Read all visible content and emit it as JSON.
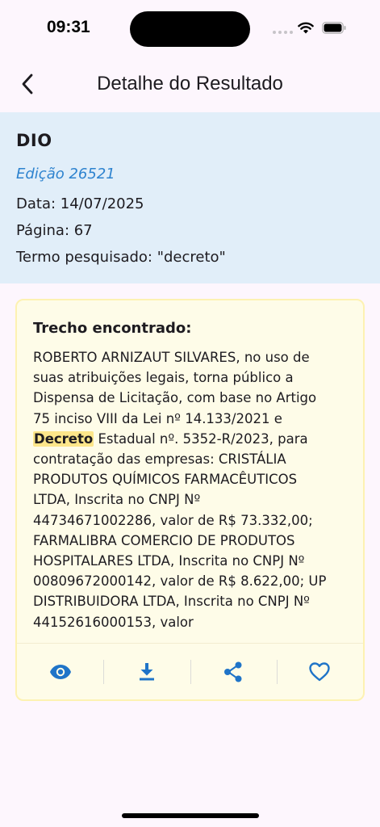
{
  "status_bar": {
    "time": "09:31"
  },
  "app_bar": {
    "title": "Detalhe do Resultado"
  },
  "result": {
    "source": "DIO",
    "edition": "Edição 26521",
    "date": "Data: 14/07/2025",
    "page": "Página: 67",
    "search_term": "Termo pesquisado: \"decreto\""
  },
  "excerpt": {
    "heading": "Trecho encontrado:",
    "highlight": "Decreto",
    "lines_before": [
      "ROBERTO ARNIZAUT SILVARES, no uso de",
      "suas atribuições legais, torna público a",
      "Dispensa de Licitação, com base no Artigo",
      "75 inciso VIII da Lei nº 14.133/2021 e"
    ],
    "highlight_line_rest": " Estadual nº. 5352-R/2023, para",
    "lines_after": [
      "contratação das empresas: CRISTÁLIA",
      "PRODUTOS QUÍMICOS FARMACÊUTICOS",
      "LTDA, Inscrita no CNPJ Nº",
      "44734671002286, valor de R$ 73.332,00;",
      "FARMALIBRA COMERCIO DE PRODUTOS",
      "HOSPITALARES LTDA, Inscrita no CNPJ Nº",
      "00809672000142, valor de R$ 8.622,00; UP",
      "DISTRIBUIDORA LTDA, Inscrita no CNPJ Nº",
      "44152616000153, valor"
    ]
  },
  "actions": [
    {
      "icon": "eye-icon"
    },
    {
      "icon": "download-icon"
    },
    {
      "icon": "share-icon"
    },
    {
      "icon": "heart-outline-icon"
    }
  ],
  "colors": {
    "accent": "#1f74c8",
    "header_bg": "#e1eef9",
    "card_bg": "#fefce8",
    "highlight": "#fde68a"
  }
}
